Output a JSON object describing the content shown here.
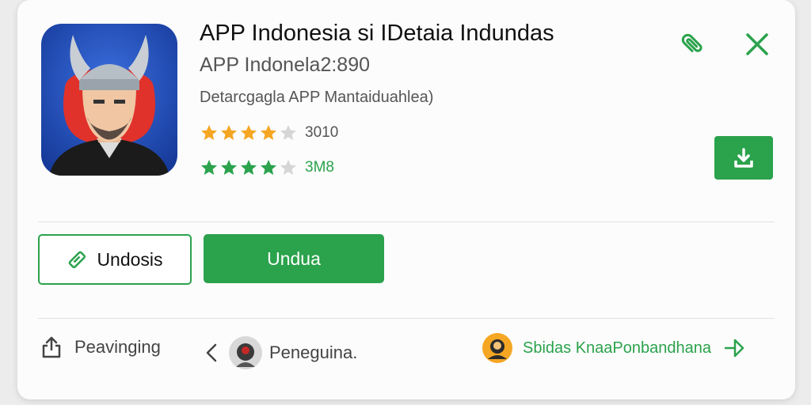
{
  "app": {
    "title": "APP Indonesia si IDetaia Indundas",
    "subtitle": "APP Indonela2:890",
    "description": "Detarcgagla APP Mantaiduahlea)",
    "ratings": [
      {
        "value": "3010",
        "stars": 4,
        "color": "#f5a623"
      },
      {
        "value": "3M8",
        "stars": 4,
        "color": "#2ba24c"
      }
    ]
  },
  "header_icons": {
    "attach": "paperclip-icon",
    "close": "close-icon"
  },
  "actions": {
    "secondary_label": "Undosis",
    "primary_label": "Undua",
    "download_icon": "download-icon"
  },
  "footer": {
    "share_label": "Peavinging",
    "user_label": "Peneguina.",
    "developer_label": "Sbidas KnaaPonbandhana"
  },
  "colors": {
    "accent": "#2ba24c",
    "star_gold": "#f5a623",
    "icon_bg": "#1d4ab5"
  }
}
